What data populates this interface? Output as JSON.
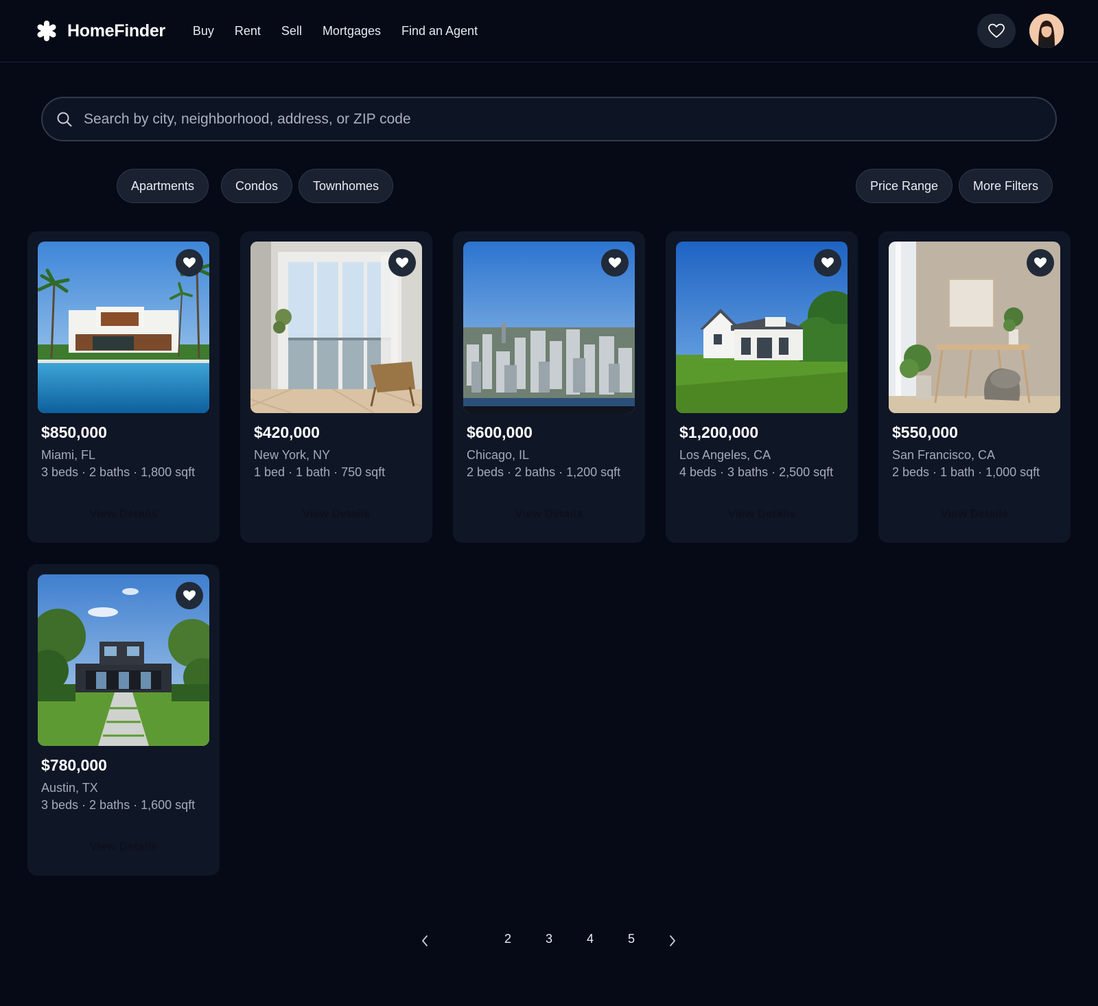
{
  "app": {
    "brand": "HomeFinder"
  },
  "nav": [
    "Buy",
    "Rent",
    "Sell",
    "Mortgages",
    "Find an Agent"
  ],
  "search": {
    "placeholder": "Search by city, neighborhood, address, or ZIP code",
    "value": ""
  },
  "filters": {
    "types": [
      "Apartments",
      "Condos",
      "Townhomes"
    ],
    "price_range": "Price Range",
    "more_filters": "More Filters"
  },
  "listings": [
    {
      "price": "$850,000",
      "location": "Miami, FL",
      "specs": "3 beds · 2 baths · 1,800 sqft",
      "cta": "View Details"
    },
    {
      "price": "$420,000",
      "location": "New York, NY",
      "specs": "1 bed · 1 bath · 750 sqft",
      "cta": "View Details"
    },
    {
      "price": "$600,000",
      "location": "Chicago, IL",
      "specs": "2 beds · 2 baths · 1,200 sqft",
      "cta": "View Details"
    },
    {
      "price": "$1,200,000",
      "location": "Los Angeles, CA",
      "specs": "4 beds · 3 baths · 2,500 sqft",
      "cta": "View Details"
    },
    {
      "price": "$550,000",
      "location": "San Francisco, CA",
      "specs": "2 beds · 1 bath · 1,000 sqft",
      "cta": "View Details"
    },
    {
      "price": "$780,000",
      "location": "Austin, TX",
      "specs": "3 beds · 2 baths · 1,600 sqft",
      "cta": "View Details"
    }
  ],
  "pagination": {
    "pages": [
      "2",
      "3",
      "4",
      "5"
    ]
  },
  "colors": {
    "background": "#050a16",
    "card": "#0f1626",
    "chip": "#1a2130",
    "text": "#e8ecf3",
    "muted": "#a3abb9"
  }
}
